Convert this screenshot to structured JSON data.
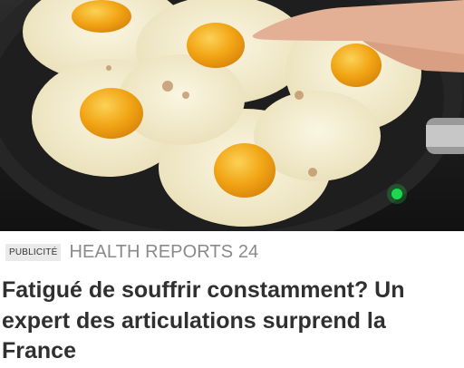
{
  "ad": {
    "sponsored_label": "PUBLICITÉ",
    "source": "HEALTH REPORTS 24",
    "headline": "Fatigué de souffrir constamment? Un expert des articulations surprend la France"
  },
  "image": {
    "subject": "fried-eggs-in-pan-photo",
    "colors": {
      "pan": "#2a2a2a",
      "egg_white": "#f3eccf",
      "yolk": "#f2a616",
      "skin": "#e8b79b",
      "indicator": "#1bd84f"
    }
  }
}
